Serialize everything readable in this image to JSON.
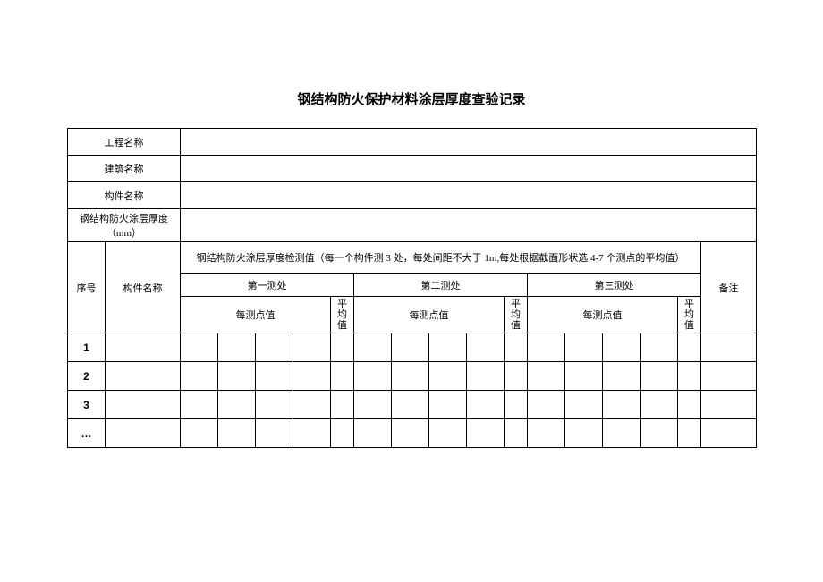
{
  "title": "钢结构防火保护材料涂层厚度查验记录",
  "headers": {
    "project_name": "工程名称",
    "building_name": "建筑名称",
    "component_name": "构件名称",
    "coating_thickness": "钢结构防火涂层厚度（mm）"
  },
  "table": {
    "note": "钢结构防火涂层厚度检测值（每一个构件测 3 处，每处间距不大于 1m,每处根据截面形状选 4-7 个测点的平均值）",
    "remark": "备注",
    "seq": "序号",
    "comp_name": "构件名称",
    "section1": "第一测处",
    "section2": "第二测处",
    "section3": "第三测处",
    "point_value": "每测点值",
    "avg": "平均值"
  },
  "rows": {
    "r1": "1",
    "r2": "2",
    "r3": "3",
    "r4": "…"
  }
}
